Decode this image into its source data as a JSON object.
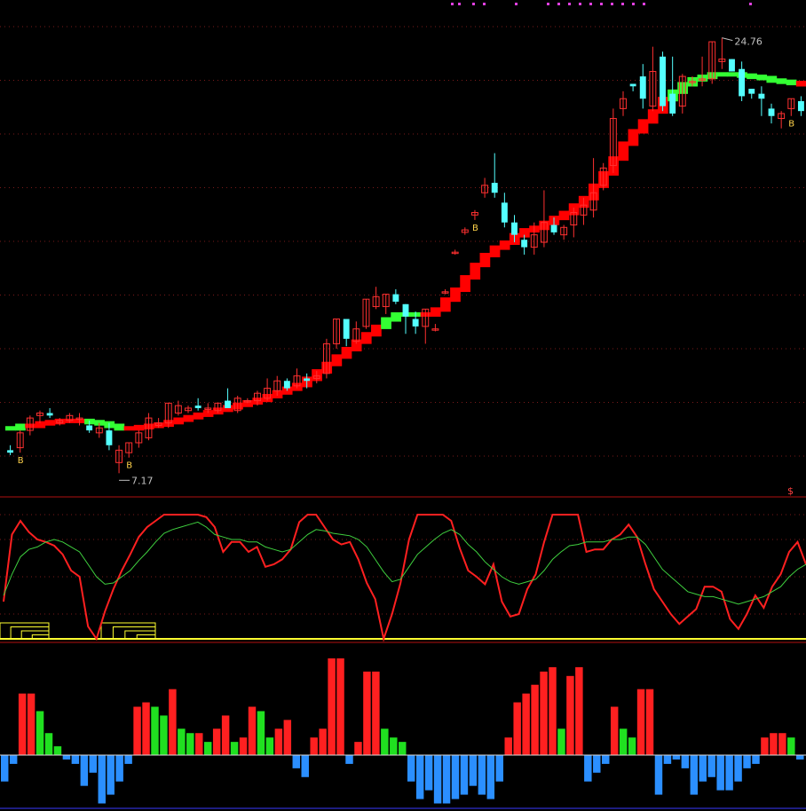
{
  "chart_data": [
    {
      "type": "candlestick",
      "title": "",
      "ylim": [
        6.5,
        26.0
      ],
      "annotations": {
        "high_label": "24.76",
        "low_label": "7.17",
        "buy_marker": "B",
        "corner_marker": "$"
      },
      "colors": {
        "up": "#ff3030",
        "down": "#54ffff",
        "trend_up": "#ff0000",
        "trend_down": "#33ff33",
        "grid": "#7a1a1a"
      },
      "candles": [
        {
          "o": 8.1,
          "h": 8.3,
          "l": 7.9,
          "c": 8.0
        },
        {
          "o": 8.2,
          "h": 8.9,
          "l": 8.0,
          "c": 8.8
        },
        {
          "o": 8.9,
          "h": 9.5,
          "l": 8.7,
          "c": 9.4
        },
        {
          "o": 9.5,
          "h": 9.7,
          "l": 9.2,
          "c": 9.6
        },
        {
          "o": 9.6,
          "h": 9.8,
          "l": 9.4,
          "c": 9.5
        },
        {
          "o": 9.2,
          "h": 9.4,
          "l": 9.1,
          "c": 9.3
        },
        {
          "o": 9.3,
          "h": 9.6,
          "l": 9.2,
          "c": 9.5
        },
        {
          "o": 9.4,
          "h": 9.6,
          "l": 9.1,
          "c": 9.4
        },
        {
          "o": 9.1,
          "h": 9.3,
          "l": 8.8,
          "c": 8.9
        },
        {
          "o": 8.8,
          "h": 9.2,
          "l": 8.6,
          "c": 9.0
        },
        {
          "o": 8.9,
          "h": 9.2,
          "l": 8.1,
          "c": 8.3
        },
        {
          "o": 7.6,
          "h": 8.3,
          "l": 7.17,
          "c": 8.1
        },
        {
          "o": 8.0,
          "h": 8.4,
          "l": 7.8,
          "c": 8.4
        },
        {
          "o": 8.4,
          "h": 8.9,
          "l": 8.2,
          "c": 8.8
        },
        {
          "o": 8.6,
          "h": 9.6,
          "l": 8.5,
          "c": 9.4
        },
        {
          "o": 9.1,
          "h": 9.4,
          "l": 9.0,
          "c": 9.2
        },
        {
          "o": 9.2,
          "h": 10.0,
          "l": 9.0,
          "c": 10.0
        },
        {
          "o": 9.6,
          "h": 10.1,
          "l": 9.5,
          "c": 9.9
        },
        {
          "o": 9.7,
          "h": 9.9,
          "l": 9.6,
          "c": 9.8
        },
        {
          "o": 9.9,
          "h": 10.2,
          "l": 9.7,
          "c": 9.8
        },
        {
          "o": 9.8,
          "h": 10.0,
          "l": 9.6,
          "c": 9.8
        },
        {
          "o": 9.7,
          "h": 10.0,
          "l": 9.6,
          "c": 10.0
        },
        {
          "o": 10.1,
          "h": 10.6,
          "l": 9.9,
          "c": 9.8
        },
        {
          "o": 9.7,
          "h": 10.3,
          "l": 9.6,
          "c": 10.2
        },
        {
          "o": 10.1,
          "h": 10.2,
          "l": 10.0,
          "c": 10.1
        },
        {
          "o": 10.1,
          "h": 10.5,
          "l": 9.9,
          "c": 10.4
        },
        {
          "o": 10.2,
          "h": 11.0,
          "l": 10.1,
          "c": 10.6
        },
        {
          "o": 10.5,
          "h": 11.1,
          "l": 10.3,
          "c": 10.9
        },
        {
          "o": 10.9,
          "h": 11.0,
          "l": 10.5,
          "c": 10.6
        },
        {
          "o": 10.7,
          "h": 11.4,
          "l": 10.6,
          "c": 11.1
        },
        {
          "o": 11.0,
          "h": 11.2,
          "l": 10.6,
          "c": 10.9
        },
        {
          "o": 11.0,
          "h": 11.3,
          "l": 10.8,
          "c": 11.1
        },
        {
          "o": 11.2,
          "h": 12.6,
          "l": 11.0,
          "c": 12.4
        },
        {
          "o": 12.4,
          "h": 13.4,
          "l": 12.2,
          "c": 13.4
        },
        {
          "o": 13.4,
          "h": 13.4,
          "l": 12.3,
          "c": 12.6
        },
        {
          "o": 12.5,
          "h": 13.3,
          "l": 12.4,
          "c": 13.0
        },
        {
          "o": 13.1,
          "h": 14.2,
          "l": 13.0,
          "c": 14.2
        },
        {
          "o": 13.9,
          "h": 14.7,
          "l": 13.8,
          "c": 14.3
        },
        {
          "o": 13.9,
          "h": 14.4,
          "l": 13.6,
          "c": 14.4
        },
        {
          "o": 14.4,
          "h": 14.6,
          "l": 14.0,
          "c": 14.1
        },
        {
          "o": 14.0,
          "h": 14.0,
          "l": 12.8,
          "c": 13.5
        },
        {
          "o": 13.4,
          "h": 13.7,
          "l": 12.8,
          "c": 13.1
        },
        {
          "o": 13.1,
          "h": 13.8,
          "l": 12.4,
          "c": 13.8
        },
        {
          "o": 13.0,
          "h": 13.2,
          "l": 12.9,
          "c": 13.0
        },
        {
          "o": 14.5,
          "h": 14.6,
          "l": 14.4,
          "c": 14.5
        },
        {
          "o": 16.1,
          "h": 16.2,
          "l": 16.0,
          "c": 16.1
        },
        {
          "o": 16.9,
          "h": 17.1,
          "l": 16.8,
          "c": 17.0
        },
        {
          "o": 17.6,
          "h": 17.8,
          "l": 17.4,
          "c": 17.7
        },
        {
          "o": 18.5,
          "h": 19.1,
          "l": 18.3,
          "c": 18.8
        },
        {
          "o": 18.9,
          "h": 20.1,
          "l": 18.3,
          "c": 18.5
        },
        {
          "o": 18.1,
          "h": 18.5,
          "l": 17.1,
          "c": 17.3
        },
        {
          "o": 17.3,
          "h": 17.6,
          "l": 16.5,
          "c": 16.8
        },
        {
          "o": 16.6,
          "h": 16.8,
          "l": 16.0,
          "c": 16.3
        },
        {
          "o": 16.3,
          "h": 17.3,
          "l": 16.0,
          "c": 16.8
        },
        {
          "o": 16.5,
          "h": 18.6,
          "l": 16.3,
          "c": 17.3
        },
        {
          "o": 17.2,
          "h": 17.5,
          "l": 16.8,
          "c": 16.9
        },
        {
          "o": 16.8,
          "h": 17.2,
          "l": 16.6,
          "c": 17.1
        },
        {
          "o": 17.2,
          "h": 17.9,
          "l": 16.7,
          "c": 17.7
        },
        {
          "o": 17.6,
          "h": 18.3,
          "l": 17.2,
          "c": 18.0
        },
        {
          "o": 17.8,
          "h": 19.9,
          "l": 17.5,
          "c": 18.5
        },
        {
          "o": 18.8,
          "h": 19.7,
          "l": 18.6,
          "c": 19.5
        },
        {
          "o": 19.6,
          "h": 21.9,
          "l": 19.3,
          "c": 21.5
        },
        {
          "o": 21.9,
          "h": 22.6,
          "l": 21.6,
          "c": 22.3
        },
        {
          "o": 22.9,
          "h": 22.9,
          "l": 22.6,
          "c": 22.8
        },
        {
          "o": 23.2,
          "h": 23.7,
          "l": 21.9,
          "c": 22.3
        },
        {
          "o": 22.0,
          "h": 24.4,
          "l": 21.8,
          "c": 23.4
        },
        {
          "o": 24.0,
          "h": 24.2,
          "l": 21.8,
          "c": 22.0
        },
        {
          "o": 22.5,
          "h": 24.0,
          "l": 21.6,
          "c": 21.7
        },
        {
          "o": 22.0,
          "h": 23.3,
          "l": 21.7,
          "c": 23.2
        },
        {
          "o": 23.0,
          "h": 23.2,
          "l": 22.8,
          "c": 23.0
        },
        {
          "o": 23.1,
          "h": 24.0,
          "l": 22.8,
          "c": 23.1
        },
        {
          "o": 23.1,
          "h": 24.6,
          "l": 22.9,
          "c": 24.6
        },
        {
          "o": 23.8,
          "h": 24.76,
          "l": 23.5,
          "c": 23.9
        },
        {
          "o": 23.9,
          "h": 23.9,
          "l": 23.4,
          "c": 23.4
        },
        {
          "o": 23.5,
          "h": 23.8,
          "l": 22.2,
          "c": 22.4
        },
        {
          "o": 22.7,
          "h": 22.7,
          "l": 22.3,
          "c": 22.5
        },
        {
          "o": 22.5,
          "h": 22.8,
          "l": 21.6,
          "c": 22.3
        },
        {
          "o": 21.9,
          "h": 22.1,
          "l": 21.3,
          "c": 21.6
        },
        {
          "o": 21.5,
          "h": 21.8,
          "l": 21.1,
          "c": 21.7
        },
        {
          "o": 21.9,
          "h": 22.3,
          "l": 21.6,
          "c": 22.3
        },
        {
          "o": 22.2,
          "h": 22.4,
          "l": 21.6,
          "c": 21.8
        }
      ],
      "trend_line": [
        9.0,
        9.1,
        9.1,
        9.2,
        9.25,
        9.3,
        9.3,
        9.3,
        9.25,
        9.2,
        9.1,
        9.0,
        9.0,
        9.05,
        9.1,
        9.15,
        9.25,
        9.35,
        9.45,
        9.55,
        9.65,
        9.75,
        9.85,
        9.95,
        10.05,
        10.15,
        10.3,
        10.45,
        10.6,
        10.75,
        11.0,
        11.3,
        11.6,
        11.9,
        12.2,
        12.5,
        12.8,
        13.1,
        13.4,
        13.6,
        13.6,
        13.6,
        13.6,
        13.8,
        14.2,
        14.6,
        15.1,
        15.6,
        16.0,
        16.3,
        16.5,
        16.8,
        17.0,
        17.1,
        17.3,
        17.5,
        17.7,
        18.0,
        18.3,
        18.8,
        19.3,
        19.9,
        20.5,
        21.0,
        21.4,
        21.8,
        22.3,
        22.6,
        22.9,
        23.1,
        23.2,
        23.3,
        23.3,
        23.3,
        23.25,
        23.2,
        23.15,
        23.05,
        23.0,
        22.95,
        22.9,
        22.9,
        22.9
      ],
      "trend_down_segments": [
        [
          0,
          1
        ],
        [
          8,
          11
        ],
        [
          38,
          41
        ],
        [
          67,
          79
        ]
      ],
      "buy_marker_indices": [
        1,
        12,
        47,
        79,
        81
      ]
    },
    {
      "type": "line",
      "title": "",
      "ylim": [
        0,
        100
      ],
      "series": [
        {
          "color": "#ff2020",
          "values": [
            30,
            84,
            95,
            86,
            80,
            78,
            75,
            68,
            55,
            50,
            10,
            0,
            22,
            40,
            55,
            68,
            82,
            90,
            95,
            100,
            100,
            100,
            100,
            100,
            98,
            90,
            70,
            78,
            78,
            70,
            74,
            58,
            60,
            64,
            72,
            94,
            100,
            100,
            90,
            80,
            76,
            78,
            64,
            45,
            32,
            0,
            20,
            45,
            80,
            100,
            100,
            100,
            100,
            95,
            73,
            55,
            50,
            44,
            60,
            30,
            18,
            20,
            40,
            52,
            78,
            100,
            100,
            100,
            100,
            70,
            72,
            72,
            80,
            84,
            92,
            82,
            60,
            40,
            30,
            20,
            12,
            18,
            24,
            42,
            42,
            38,
            16,
            8,
            20,
            35,
            25,
            42,
            52,
            70,
            78,
            60
          ]
        },
        {
          "color": "#3fd03f",
          "values": [
            35,
            52,
            66,
            72,
            74,
            78,
            80,
            78,
            74,
            70,
            60,
            50,
            44,
            45,
            50,
            55,
            63,
            70,
            78,
            85,
            88,
            90,
            92,
            94,
            90,
            84,
            82,
            80,
            80,
            78,
            78,
            74,
            72,
            70,
            72,
            78,
            84,
            88,
            87,
            85,
            84,
            83,
            80,
            74,
            64,
            54,
            46,
            48,
            58,
            68,
            74,
            80,
            85,
            88,
            84,
            76,
            70,
            62,
            56,
            50,
            46,
            44,
            46,
            48,
            55,
            64,
            70,
            75,
            76,
            78,
            78,
            78,
            80,
            80,
            82,
            82,
            76,
            66,
            56,
            50,
            44,
            38,
            36,
            34,
            34,
            32,
            30,
            28,
            30,
            32,
            34,
            38,
            42,
            50,
            56,
            60
          ]
        }
      ]
    },
    {
      "type": "bar",
      "title": "",
      "ylim": [
        -60,
        110
      ],
      "values": [
        -30,
        -10,
        70,
        70,
        50,
        25,
        10,
        -5,
        -10,
        -35,
        -20,
        -55,
        -45,
        -30,
        -10,
        55,
        60,
        55,
        45,
        75,
        30,
        25,
        25,
        15,
        30,
        45,
        15,
        20,
        55,
        50,
        20,
        30,
        40,
        -15,
        -25,
        20,
        30,
        110,
        110,
        -10,
        15,
        95,
        95,
        30,
        20,
        15,
        -30,
        -50,
        -40,
        -55,
        -55,
        -50,
        -45,
        -35,
        -45,
        -50,
        -30,
        20,
        60,
        70,
        80,
        95,
        100,
        30,
        90,
        100,
        -30,
        -20,
        -10,
        55,
        30,
        20,
        75,
        75,
        -45,
        -10,
        -5,
        -15,
        -45,
        -30,
        -25,
        -40,
        -40,
        -30,
        -15,
        -10,
        20,
        25,
        25,
        20,
        -5
      ],
      "positive_colors": [
        "#ff2020",
        "#20e020"
      ],
      "negative_color": "#2b8fff"
    }
  ]
}
